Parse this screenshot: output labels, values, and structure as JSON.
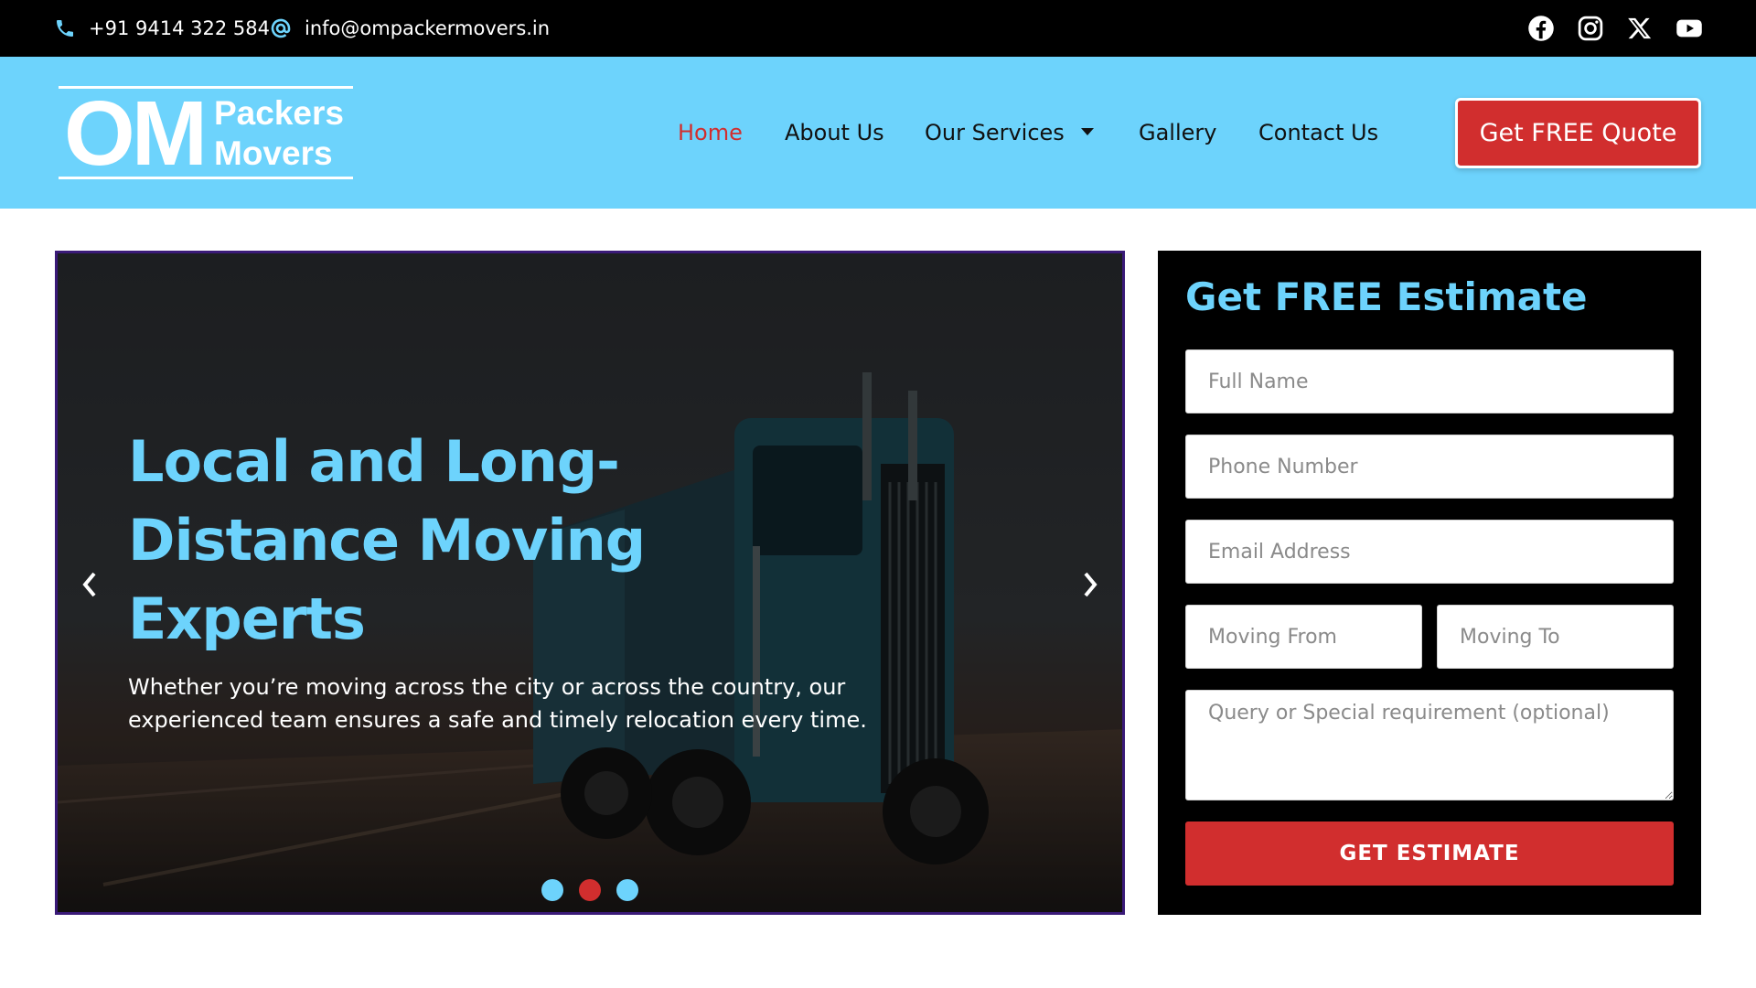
{
  "topbar": {
    "phone": "+91 9414 322 584",
    "email": "info@ompackermovers.in",
    "socials": [
      "facebook-icon",
      "instagram-icon",
      "x-icon",
      "youtube-icon"
    ]
  },
  "logo": {
    "big": "OM",
    "line1": "Packers",
    "line2": "Movers"
  },
  "nav": {
    "items": [
      {
        "label": "Home",
        "active": true
      },
      {
        "label": "About Us"
      },
      {
        "label": "Our Services",
        "dropdown": true
      },
      {
        "label": "Gallery"
      },
      {
        "label": "Contact Us"
      }
    ]
  },
  "header": {
    "cta_label": "Get FREE Quote"
  },
  "hero": {
    "heading": "Local and Long-Distance Moving Experts",
    "subtext": "Whether you’re moving across the city or across the country, our experienced team ensures a safe and timely relocation every time.",
    "slides": 3,
    "active_slide": 2
  },
  "form": {
    "title": "Get FREE Estimate",
    "full_name_placeholder": "Full Name",
    "phone_placeholder": "Phone Number",
    "email_placeholder": "Email Address",
    "from_placeholder": "Moving From",
    "to_placeholder": "Moving To",
    "query_placeholder": "Query or Special requirement (optional)",
    "submit_label": "GET ESTIMATE"
  },
  "colors": {
    "accent_blue": "#6dd3fc",
    "accent_red": "#d12e2e",
    "topbar_bg": "#000000"
  }
}
